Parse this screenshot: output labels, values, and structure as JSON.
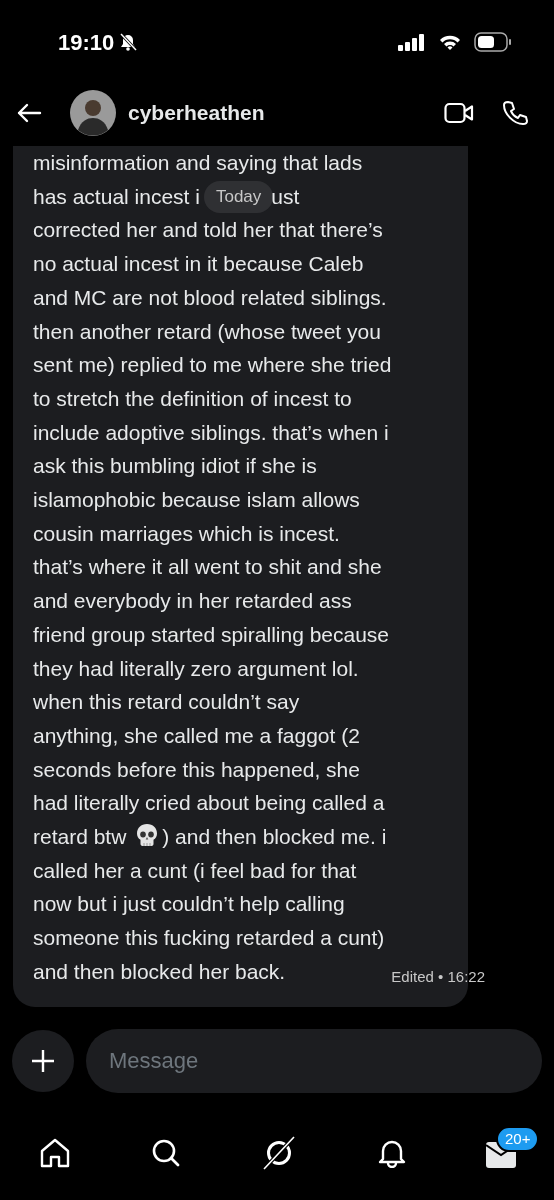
{
  "status_bar": {
    "time": "19:10"
  },
  "header": {
    "name": "cyberheathen"
  },
  "message": {
    "top_line": "misinformation and saying that lads",
    "split_line": {
      "before": "has actual incest i",
      "after": "ust"
    },
    "divider": "Today",
    "body_lines": [
      "corrected her and told her that there’s",
      "no actual incest in it because Caleb",
      "and MC are not blood related siblings.",
      "then another retard (whose tweet you",
      "sent me) replied to me where she tried",
      "to stretch the definition of incest to",
      "include adoptive siblings. that’s when i",
      "ask this bumbling idiot if she is",
      "islamophobic because islam allows",
      "cousin marriages which is incest.",
      "that’s where it all went to shit and she",
      "and everybody in her retarded ass",
      "friend group started spiralling because",
      "they had literally zero argument lol.",
      "when this retard couldn’t say",
      "anything, she called me a faggot (2",
      "seconds before this happened, she",
      "had literally cried about being called a",
      {
        "before": "retard btw",
        "after": ") and then blocked me. i"
      },
      "called her a cunt (i feel bad for that",
      "now but i just couldn’t help calling",
      "someone this fucking retarded a cunt)",
      "and then blocked her back."
    ],
    "meta": "Edited • 16:22"
  },
  "composer": {
    "placeholder": "Message"
  },
  "tab_bar": {
    "badge": "20+"
  }
}
